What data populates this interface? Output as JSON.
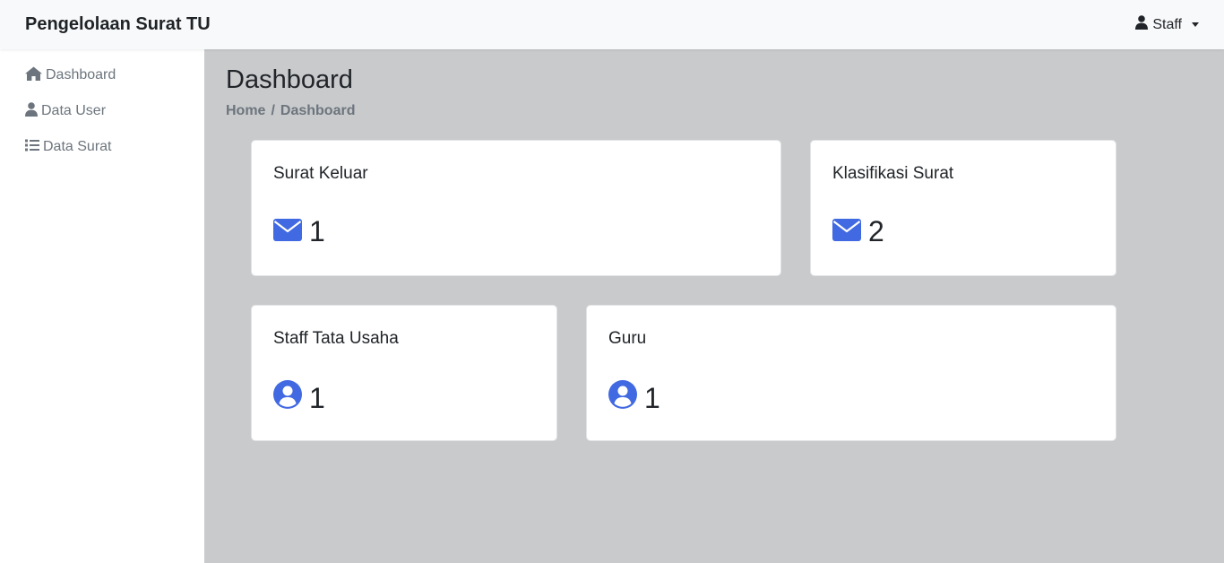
{
  "navbar": {
    "brand": "Pengelolaan Surat TU",
    "user_label": "Staff"
  },
  "sidebar": {
    "items": [
      {
        "label": "Dashboard",
        "icon": "home-icon"
      },
      {
        "label": "Data User",
        "icon": "user-icon"
      },
      {
        "label": "Data Surat",
        "icon": "list-icon"
      }
    ]
  },
  "main": {
    "title": "Dashboard",
    "breadcrumb": {
      "home": "Home",
      "separator": "/",
      "current": "Dashboard"
    },
    "cards": [
      {
        "title": "Surat Keluar",
        "value": "1",
        "icon": "envelope-icon"
      },
      {
        "title": "Klasifikasi Surat",
        "value": "2",
        "icon": "envelope-icon"
      },
      {
        "title": "Staff Tata Usaha",
        "value": "1",
        "icon": "user-circle-icon"
      },
      {
        "title": "Guru",
        "value": "1",
        "icon": "user-circle-icon"
      }
    ]
  },
  "colors": {
    "accent": "#4169e1",
    "background": "#c9cacc",
    "navbar": "#f8f9fa",
    "muted_text": "#6c757d"
  }
}
